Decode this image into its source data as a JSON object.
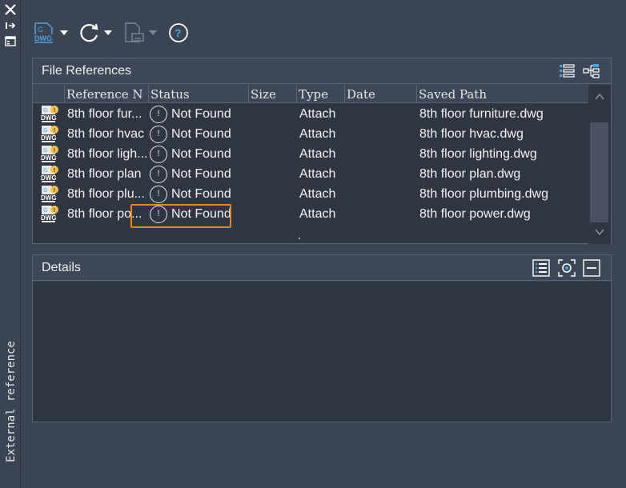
{
  "palette": {
    "background": "#3b4453",
    "panel_body": "#2f3642",
    "border": "#5a6373",
    "highlight": "#f0850f",
    "accent_blue": "#4aa3df"
  },
  "sidebar": {
    "title": "External reference"
  },
  "toolbar": {
    "items": [
      {
        "name": "attach-dwg",
        "icon": "dwg-attach-icon",
        "icon_text": "DWG"
      },
      {
        "name": "refresh",
        "icon": "refresh-icon"
      },
      {
        "name": "change-path",
        "icon": "change-path-icon"
      },
      {
        "name": "help",
        "icon": "help-icon",
        "text": "?"
      }
    ]
  },
  "file_references": {
    "title": "File References",
    "columns": [
      "Reference N",
      "Status",
      "Size",
      "Type",
      "Date",
      "Saved Path"
    ],
    "rows": [
      {
        "name": "8th floor fur...",
        "status": "Not Found",
        "size": "",
        "type": "Attach",
        "date": "",
        "saved_path": "8th floor furniture.dwg"
      },
      {
        "name": "8th floor hvac",
        "status": "Not Found",
        "size": "",
        "type": "Attach",
        "date": "",
        "saved_path": "8th floor hvac.dwg"
      },
      {
        "name": "8th floor ligh...",
        "status": "Not Found",
        "size": "",
        "type": "Attach",
        "date": "",
        "saved_path": "8th floor lighting.dwg"
      },
      {
        "name": "8th floor plan",
        "status": "Not Found",
        "size": "",
        "type": "Attach",
        "date": "",
        "saved_path": "8th floor plan.dwg"
      },
      {
        "name": "8th floor plu...",
        "status": "Not Found",
        "size": "",
        "type": "Attach",
        "date": "",
        "saved_path": "8th floor plumbing.dwg"
      },
      {
        "name": "8th floor po...",
        "status": "Not Found",
        "size": "",
        "type": "Attach",
        "date": "",
        "saved_path": "8th floor power.dwg"
      }
    ],
    "file_icon_text": "DWG",
    "status_icon_text": "!",
    "view_icons": [
      "list-view-icon",
      "tree-view-icon"
    ]
  },
  "details": {
    "title": "Details",
    "icons": [
      "details-list-icon",
      "preview-icon",
      "collapse-icon"
    ]
  }
}
